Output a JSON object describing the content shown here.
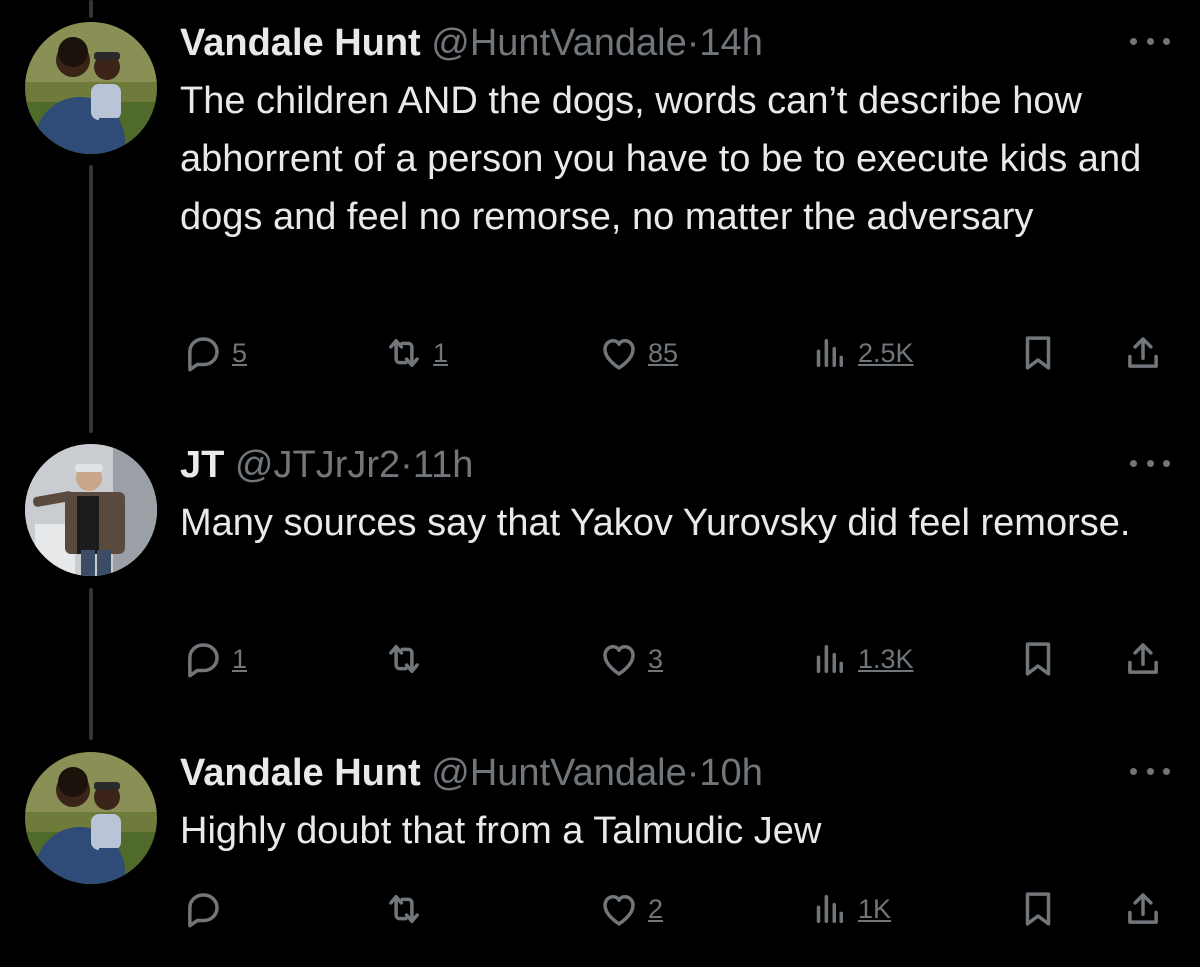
{
  "tweets": [
    {
      "name": "Vandale Hunt",
      "handle": "@HuntVandale",
      "separator": "·",
      "time": "14h",
      "text": "The children AND the dogs, words can’t describe how abhorrent of a person you have to be to execute kids and dogs and feel no remorse, no matter the adversary",
      "replies": "5",
      "retweets": "1",
      "likes": "85",
      "views": "2.5K"
    },
    {
      "name": "JT",
      "handle": "@JTJrJr2",
      "separator": "·",
      "time": "11h",
      "text": "Many sources say that Yakov Yurovsky did feel remorse.",
      "replies": "1",
      "retweets": "",
      "likes": "3",
      "views": "1.3K"
    },
    {
      "name": "Vandale Hunt",
      "handle": "@HuntVandale",
      "separator": "·",
      "time": "10h",
      "text": "Highly doubt that from a Talmudic Jew",
      "replies": "",
      "retweets": "",
      "likes": "2",
      "views": "1K"
    }
  ],
  "colors": {
    "background": "#000000",
    "text": "#e7e9ea",
    "secondary": "#71767b",
    "thread_line": "#333639"
  },
  "icons": [
    "reply-icon",
    "retweet-icon",
    "like-icon",
    "views-icon",
    "bookmark-icon",
    "share-icon",
    "more-icon"
  ]
}
